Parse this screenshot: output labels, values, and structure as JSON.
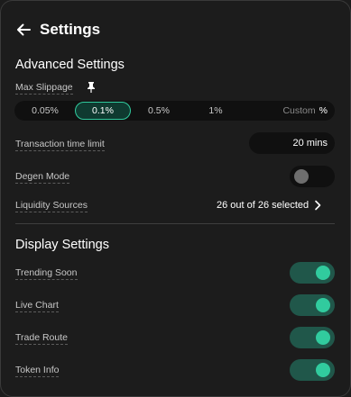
{
  "header": {
    "title": "Settings"
  },
  "advanced": {
    "title": "Advanced Settings",
    "max_slippage": {
      "label": "Max Slippage",
      "options": [
        "0.05%",
        "0.1%",
        "0.5%",
        "1%"
      ],
      "selected": "0.1%",
      "custom_placeholder": "Custom",
      "custom_suffix": "%"
    },
    "time_limit": {
      "label": "Transaction time limit",
      "value": "20 mins"
    },
    "degen_mode": {
      "label": "Degen Mode",
      "enabled": false
    },
    "liquidity": {
      "label": "Liquidity Sources",
      "value": "26 out of 26 selected"
    }
  },
  "display": {
    "title": "Display Settings",
    "items": [
      {
        "label": "Trending Soon",
        "enabled": true
      },
      {
        "label": "Live Chart",
        "enabled": true
      },
      {
        "label": "Trade Route",
        "enabled": true
      },
      {
        "label": "Token Info",
        "enabled": true
      }
    ]
  },
  "colors": {
    "background": "#1c1c1c",
    "accent": "#31cb9e",
    "toggle_on_track": "#20574a",
    "pill_background": "#101010"
  },
  "icons": {
    "back": "arrow-left-icon",
    "pin": "pin-icon",
    "chevron": "chevron-right-icon"
  }
}
